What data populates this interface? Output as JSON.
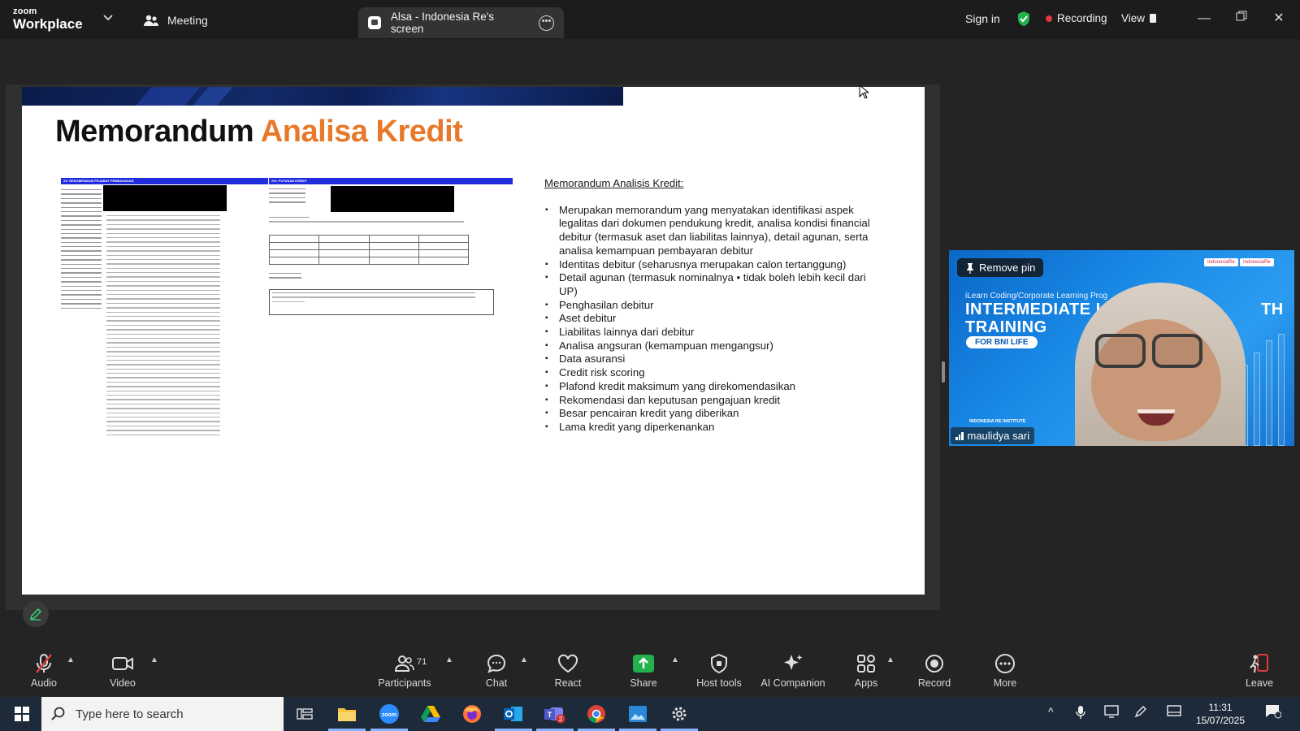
{
  "titlebar": {
    "brand_top": "zoom",
    "brand_main": "Workplace",
    "meeting_label": "Meeting",
    "tab_label": "Alsa - Indonesia Re's screen",
    "sign_in": "Sign in",
    "recording": "Recording",
    "view": "View",
    "window_controls": [
      "minimize-icon",
      "restore-icon",
      "close-icon"
    ]
  },
  "slide": {
    "title_part1": "Memorandum",
    "title_part2": "Analisa Kredit",
    "accent_color": "#e8792a",
    "doc1_header": "XV. REKOMENDASI PEJABAT PEMBAHASAN",
    "doc2_header": "XVI. PUTUSAN KREDIT",
    "memo_title": "Memorandum Analisis Kredit:",
    "memo_items": [
      "Merupakan memorandum yang menyatakan identifikasi aspek legalitas dari dokumen pendukung kredit, analisa kondisi financial debitur (termasuk aset dan liabilitas lainnya), detail agunan, serta analisa kemampuan pembayaran debitur",
      "Identitas debitur (seharusnya merupakan calon tertanggung)",
      "Detail agunan (termasuk nominalnya • tidak boleh lebih kecil dari UP)",
      "Penghasilan debitur",
      "Aset debitur",
      "Liabilitas lainnya dari debitur",
      "Analisa angsuran (kemampuan mengangsur)",
      "Data asuransi",
      "Credit risk scoring",
      "Plafond kredit maksimum yang direkomendasikan",
      "Rekomendasi dan keputusan pengajuan kredit",
      "Besar pencairan kredit yang diberikan",
      "Lama kredit yang diperkenankan"
    ]
  },
  "video": {
    "unpin_label": "Remove pin",
    "line1": "iLearn Coding/Corporate Learning Prog",
    "line2": "INTERMEDIATE LIF",
    "line2b": "TH",
    "line3": "TRAINING",
    "pill": "FOR BNI LIFE",
    "participant_name": "maulidya sari",
    "logo_left": "IndonesiaRe",
    "logo_right": "IndonesiaRe",
    "footer_logo": "INDONESIA RE INSTITUTE"
  },
  "toolbar": {
    "audio": "Audio",
    "video": "Video",
    "participants": "Participants",
    "participants_count": "71",
    "chat": "Chat",
    "react": "React",
    "share": "Share",
    "host_tools": "Host tools",
    "ai_companion": "AI Companion",
    "apps": "Apps",
    "record": "Record",
    "more": "More",
    "leave": "Leave"
  },
  "taskbar": {
    "search_placeholder": "Type here to search",
    "time": "11:31",
    "date": "15/07/2025",
    "teams_badge": "2"
  }
}
